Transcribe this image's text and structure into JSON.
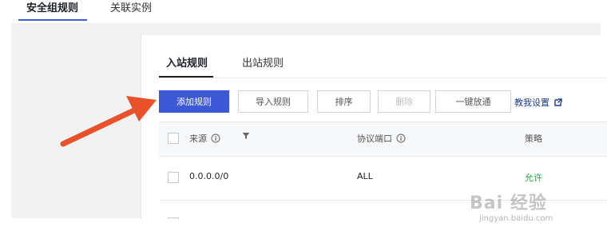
{
  "top_tabs": [
    {
      "label": "安全组规则",
      "active": true
    },
    {
      "label": "关联实例",
      "active": false
    }
  ],
  "sub_tabs": [
    {
      "label": "入站规则",
      "active": true
    },
    {
      "label": "出站规则",
      "active": false
    }
  ],
  "toolbar": {
    "add_label": "添加规则",
    "import_label": "导入规则",
    "sort_label": "排序",
    "delete_label": "删除",
    "open_all_label": "一键放通",
    "tutorial_label": "教我设置"
  },
  "table": {
    "headers": {
      "source": "来源",
      "protocol_port": "协议端口",
      "policy": "策略"
    },
    "rows": [
      {
        "source": "0.0.0.0/0",
        "protocol_port": "ALL",
        "policy": "允许"
      }
    ]
  },
  "watermark": {
    "logo": "Bai 经验",
    "url": "jingyan.baidu.com"
  },
  "colors": {
    "primary": "#3d59d6",
    "allow": "#29a745",
    "arrow": "#e8512a"
  },
  "icons": [
    "info-icon",
    "filter-icon",
    "external-link-icon",
    "annotation-arrow"
  ]
}
